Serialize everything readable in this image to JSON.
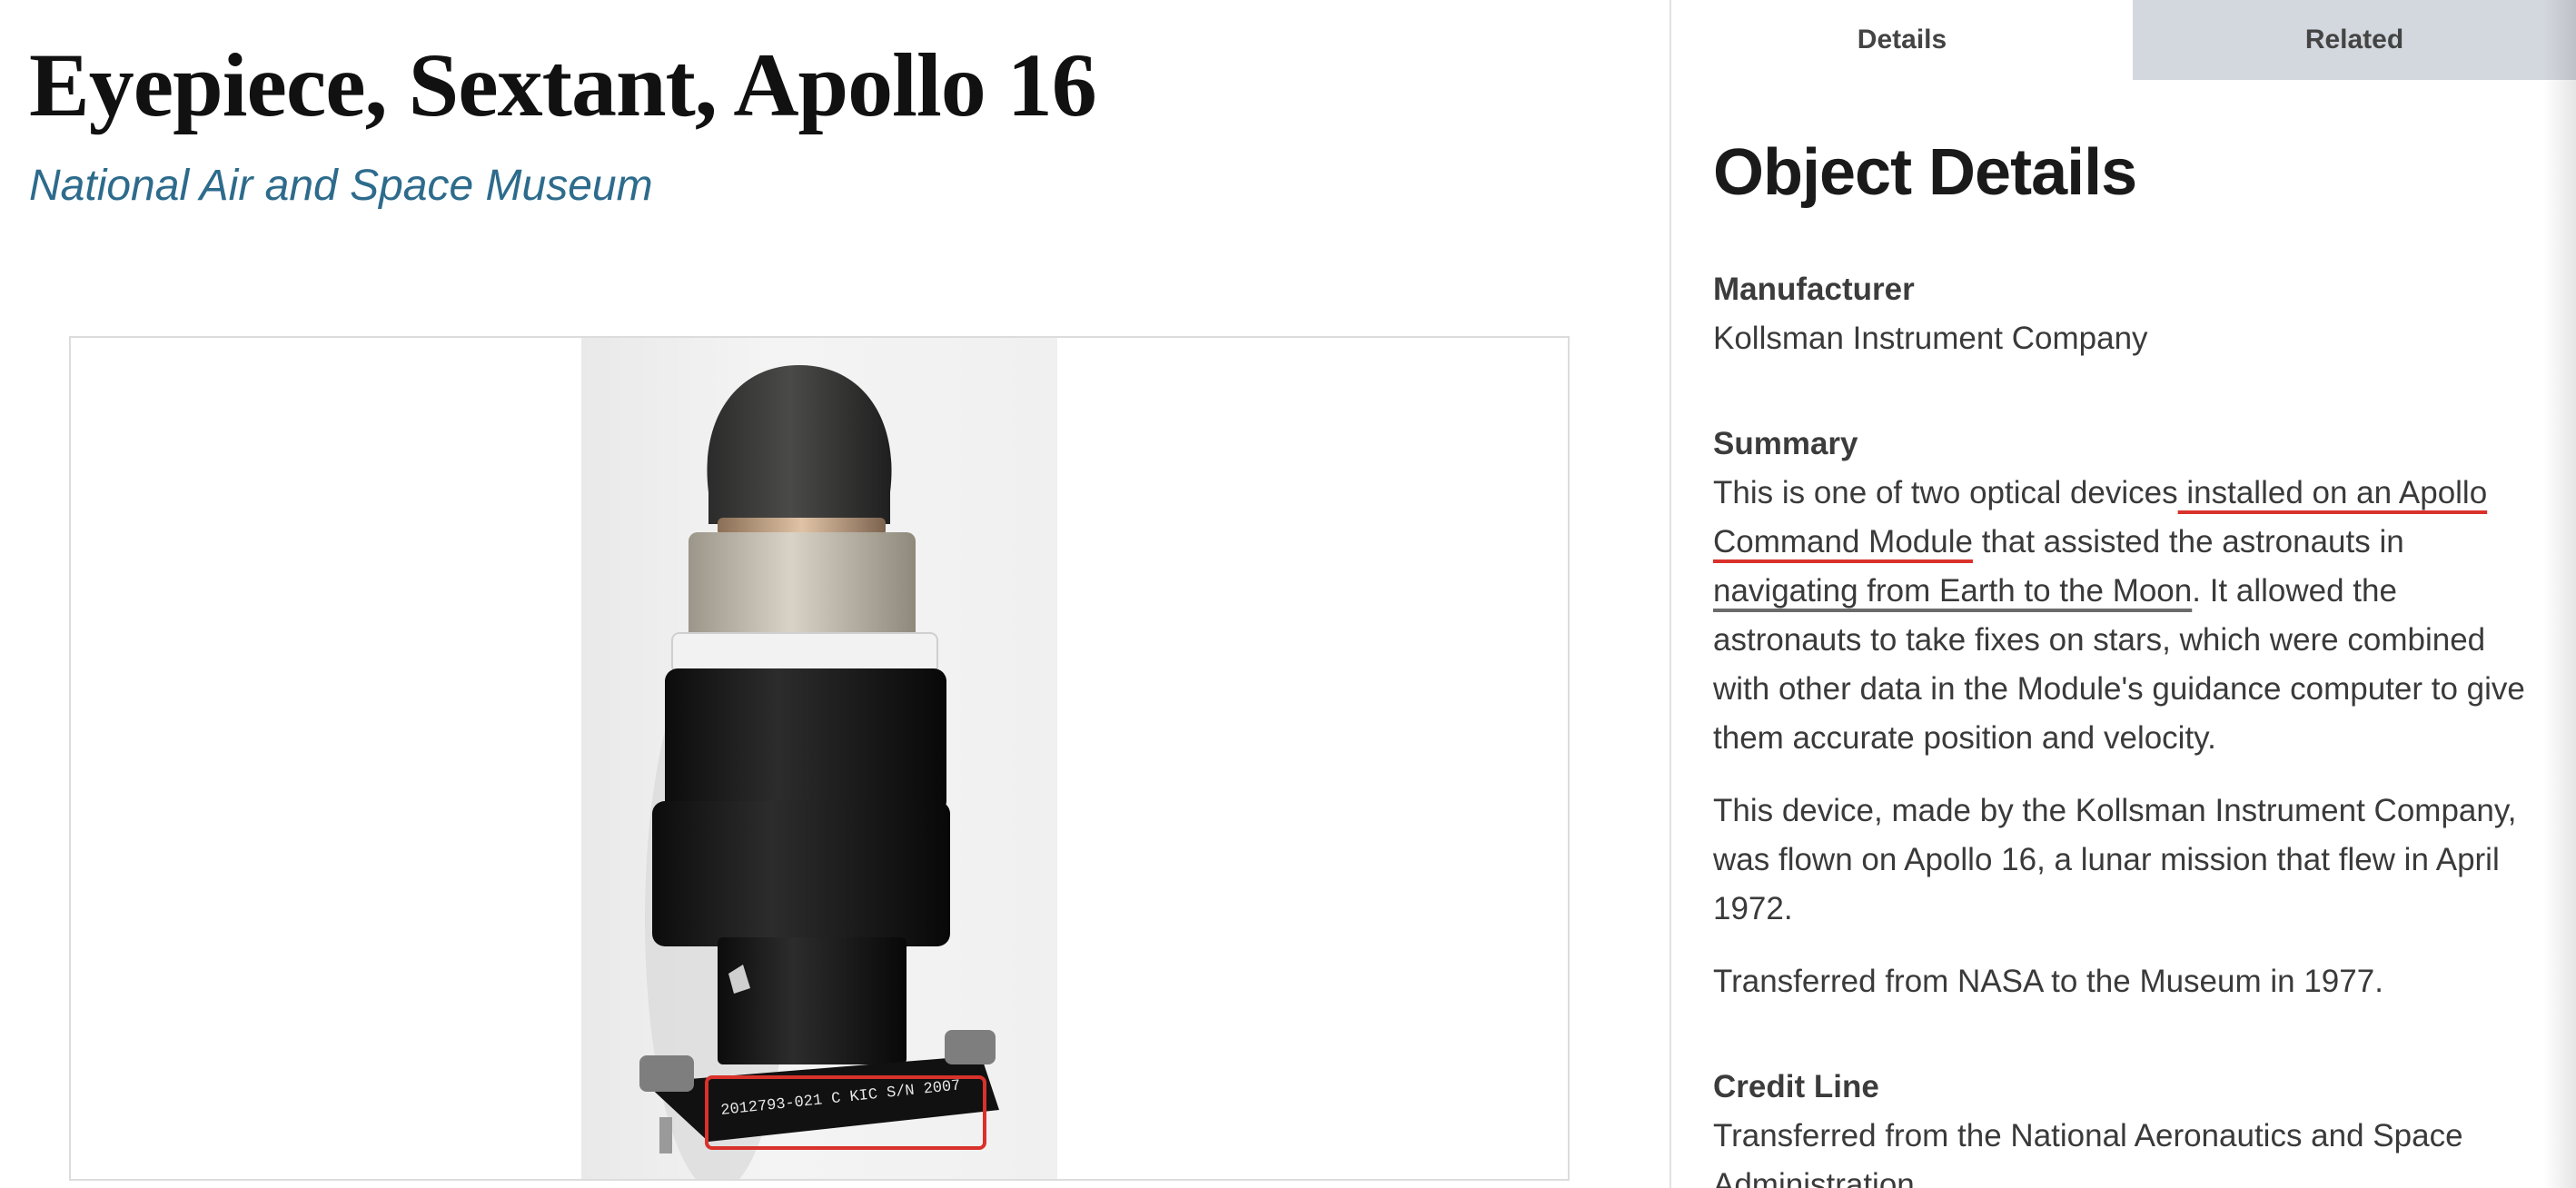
{
  "object": {
    "title": "Eyepiece, Sextant, Apollo 16",
    "unit": "National Air and Space Museum",
    "image": {
      "stamped_text": "2012793-021 C KIC S/N 2007"
    }
  },
  "tabs": [
    {
      "label": "Details",
      "active": true
    },
    {
      "label": "Related",
      "active": false
    }
  ],
  "details": {
    "heading": "Object Details",
    "manufacturer": {
      "label": "Manufacturer",
      "value": "Kollsman Instrument Company"
    },
    "summary": {
      "label": "Summary",
      "p1_part1": "This is one of two optical devices",
      "p1_mark1": " installed on an Apollo Command Module",
      "p1_part2": " that assisted the astronauts in ",
      "p1_mark2": "navigating from Earth to the Moon",
      "p1_part3": ". It allowed the astronauts to take fixes on stars, which were combined with other data in the Module's guidance computer to give them accurate position and velocity.",
      "p2": "This device, made by the Kollsman Instrument Company, was flown on Apollo 16, a lunar mission that flew in April 1972.",
      "p3": "Transferred from NASA to the Museum in 1977."
    },
    "credit_line": {
      "label": "Credit Line",
      "value": "Transferred from the National Aeronautics and Space Administration"
    }
  },
  "colors": {
    "link": "#2d6b8c",
    "tab_inactive_bg": "#d3d7de",
    "highlight_red": "#d9312b",
    "highlight_grey": "#6b6b6b"
  }
}
